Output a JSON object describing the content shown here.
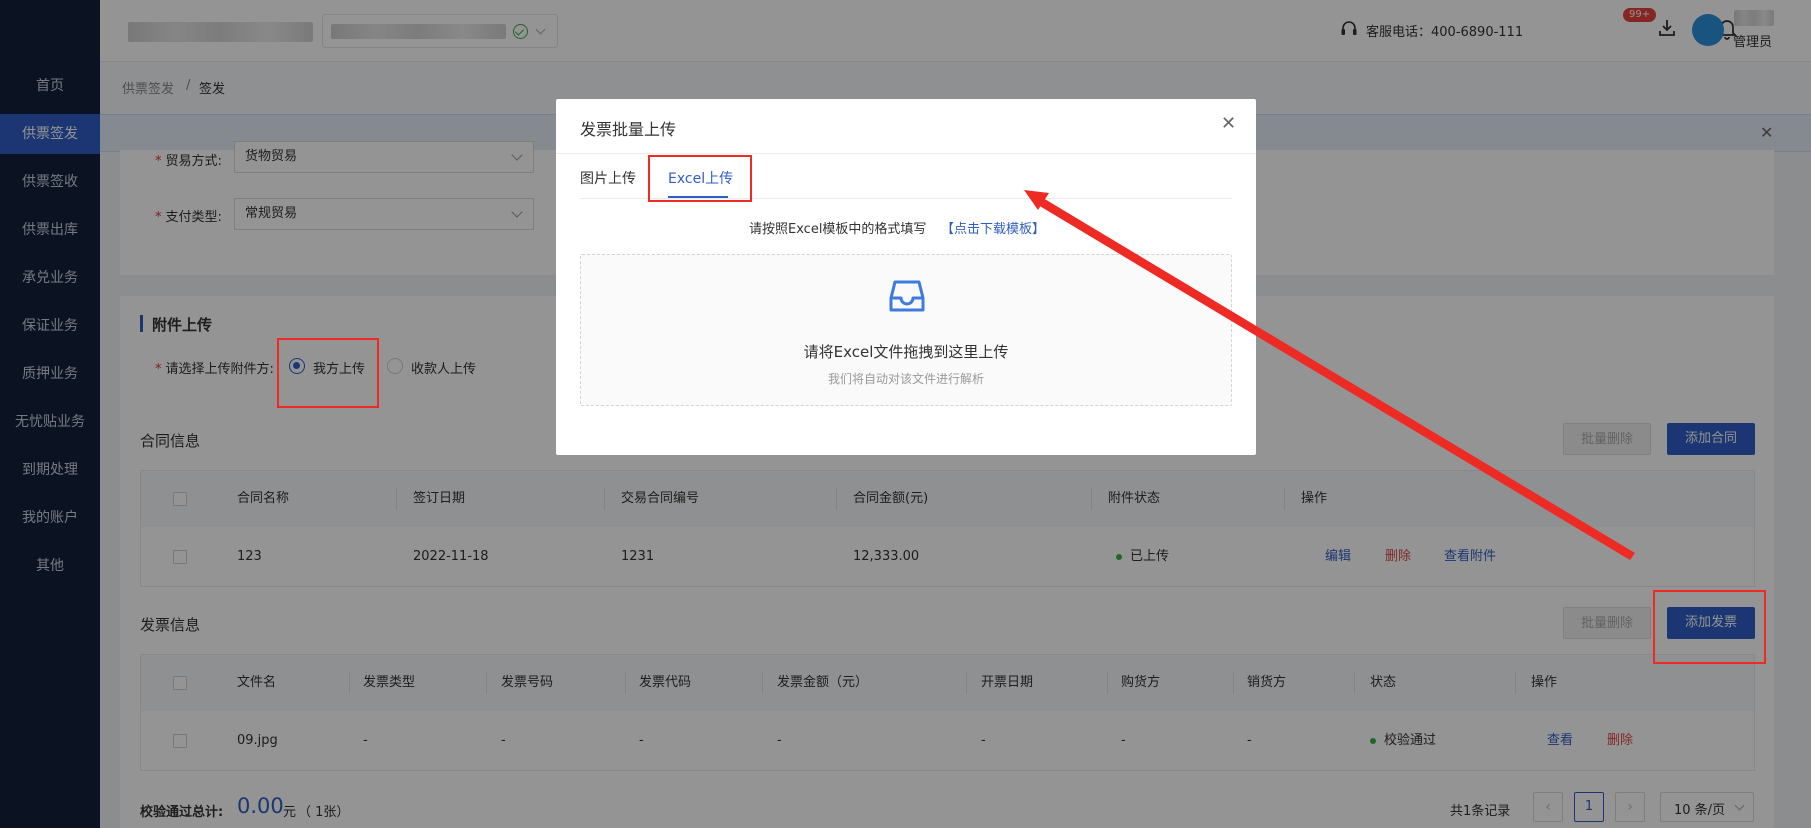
{
  "sidebar": {
    "items": [
      "首页",
      "供票签发",
      "供票签收",
      "供票出库",
      "承兑业务",
      "保证业务",
      "质押业务",
      "无忧贴业务",
      "到期处理",
      "我的账户",
      "其他"
    ],
    "active_index": 1
  },
  "header": {
    "service_label": "客服电话：400-6890-111",
    "badge": "99+",
    "user_role": "管理员"
  },
  "breadcrumb": {
    "parent": "供票签发",
    "separator": "/",
    "current": "签发"
  },
  "form": {
    "trade_label": "贸易方式:",
    "trade_value": "货物贸易",
    "pay_label": "支付类型:",
    "pay_value": "常规贸易"
  },
  "attachment": {
    "title": "附件上传",
    "choose_label": "请选择上传附件方:",
    "option_self": "我方上传",
    "option_payee": "收款人上传"
  },
  "contracts": {
    "title": "合同信息",
    "batch_delete": "批量删除",
    "add": "添加合同",
    "columns": [
      "合同名称",
      "签订日期",
      "交易合同编号",
      "合同金额(元)",
      "附件状态",
      "操作"
    ],
    "rows": [
      {
        "name": "123",
        "date": "2022-11-18",
        "number": "1231",
        "amount": "12,333.00",
        "status": "已上传",
        "edit": "编辑",
        "delete": "删除",
        "view": "查看附件"
      }
    ]
  },
  "invoices": {
    "title": "发票信息",
    "batch_delete": "批量删除",
    "add": "添加发票",
    "columns": [
      "文件名",
      "发票类型",
      "发票号码",
      "发票代码",
      "发票金额（元）",
      "开票日期",
      "购货方",
      "销货方",
      "状态",
      "操作"
    ],
    "rows": [
      {
        "file": "09.jpg",
        "type": "-",
        "number": "-",
        "code": "-",
        "amount": "-",
        "date": "-",
        "buyer": "-",
        "seller": "-",
        "status": "校验通过",
        "view": "查看",
        "delete": "删除"
      }
    ]
  },
  "footer": {
    "total_label": "校验通过总计:",
    "total_value": "0.00",
    "total_unit": "元",
    "total_count": "（ 1张）",
    "records": "共1条记录",
    "page": "1",
    "page_size": "10 条/页"
  },
  "modal": {
    "title": "发票批量上传",
    "tabs": [
      "图片上传",
      "Excel上传"
    ],
    "active_tab": 1,
    "hint": "请按照Excel模板中的格式填写",
    "template_link": "【点击下载模板】",
    "drop_title": "请将Excel文件拖拽到这里上传",
    "drop_sub": "我们将自动对该文件进行解析"
  },
  "colors": {
    "primary": "#2f5ec4",
    "sidebar": "#14213d",
    "annotation": "#ee2a24",
    "success": "#34b244"
  }
}
